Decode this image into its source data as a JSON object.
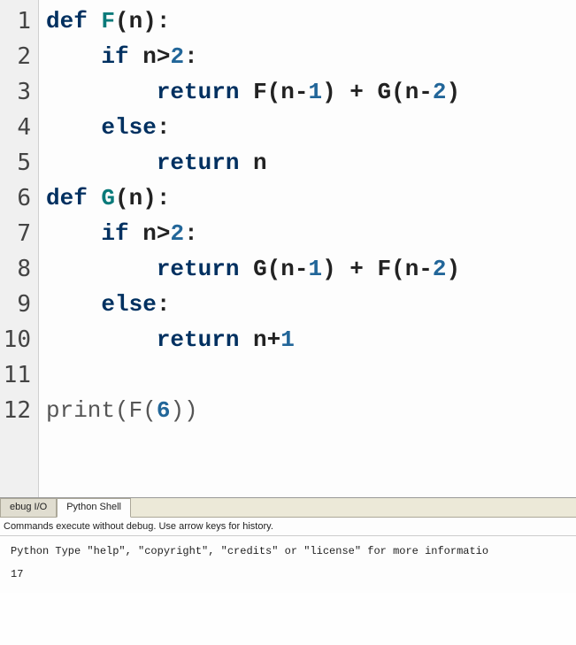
{
  "editor": {
    "line_numbers": [
      "1",
      "2",
      "3",
      "4",
      "5",
      "6",
      "7",
      "8",
      "9",
      "10",
      "11",
      "12"
    ],
    "tokens": {
      "l1": {
        "def": "def",
        "sp": " ",
        "fn": "F",
        "rest": "(n):"
      },
      "l2": {
        "indent": "    ",
        "if": "if",
        "rest": " n>",
        "num": "2",
        "colon": ":"
      },
      "l3": {
        "indent": "        ",
        "ret": "return",
        "sp": " ",
        "a": "F(n-",
        "n1": "1",
        "b": ") + G(n-",
        "n2": "2",
        "c": ")"
      },
      "l4": {
        "indent": "    ",
        "else": "else",
        "colon": ":"
      },
      "l5": {
        "indent": "        ",
        "ret": "return",
        "rest": " n"
      },
      "l6": {
        "def": "def",
        "sp": " ",
        "fn": "G",
        "rest": "(n):"
      },
      "l7": {
        "indent": "    ",
        "if": "if",
        "rest": " n>",
        "num": "2",
        "colon": ":"
      },
      "l8": {
        "indent": "        ",
        "ret": "return",
        "sp": " ",
        "a": "G(n-",
        "n1": "1",
        "b": ") + F(n-",
        "n2": "2",
        "c": ")"
      },
      "l9": {
        "indent": "    ",
        "else": "else",
        "colon": ":"
      },
      "l10": {
        "indent": "        ",
        "ret": "return",
        "rest": " n+",
        "num": "1"
      },
      "l12": {
        "print": "print",
        "a": "(F(",
        "num": "6",
        "b": "))"
      }
    }
  },
  "tabs": {
    "debug": "ebug I/O",
    "shell": "Python Shell"
  },
  "shell": {
    "header": "Commands execute without debug.  Use arrow keys for history.",
    "banner": "Python Type \"help\", \"copyright\", \"credits\" or \"license\" for more informatio",
    "output": "17"
  }
}
